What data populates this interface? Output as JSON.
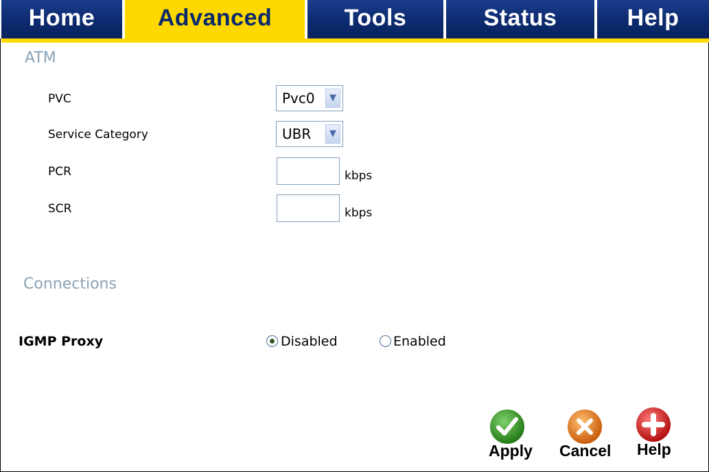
{
  "nav": {
    "tabs": [
      {
        "label": "Home"
      },
      {
        "label": "Advanced"
      },
      {
        "label": "Tools"
      },
      {
        "label": "Status"
      },
      {
        "label": "Help"
      }
    ],
    "active_tab": "Advanced",
    "colors": {
      "tab_bg": "#0c2a6e",
      "active_bg": "#ffd800",
      "accent_line": "#ffd800"
    }
  },
  "atm": {
    "title": "ATM",
    "pvc": {
      "label": "PVC",
      "value": "Pvc0"
    },
    "service_category": {
      "label": "Service Category",
      "value": "UBR"
    },
    "pcr": {
      "label": "PCR",
      "value": "",
      "unit": "kbps"
    },
    "scr": {
      "label": "SCR",
      "value": "",
      "unit": "kbps"
    }
  },
  "connections": {
    "title": "Connections",
    "igmp_proxy": {
      "label": "IGMP Proxy",
      "options": [
        {
          "label": "Disabled",
          "selected": true
        },
        {
          "label": "Enabled",
          "selected": false
        }
      ]
    }
  },
  "actions": {
    "apply": {
      "label": "Apply",
      "icon": "check-icon",
      "color": "#3a9a2a"
    },
    "cancel": {
      "label": "Cancel",
      "icon": "x-icon",
      "color": "#e07a1a"
    },
    "help": {
      "label": "Help",
      "icon": "plus-icon",
      "color": "#d01a1a"
    }
  }
}
